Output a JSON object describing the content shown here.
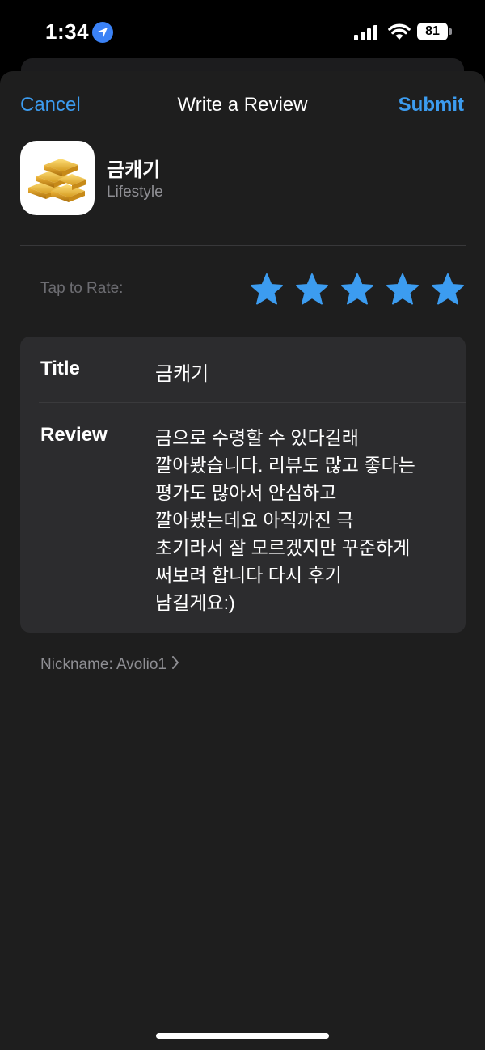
{
  "status_bar": {
    "time": "1:34",
    "battery": "81",
    "location_icon": "location-arrow-icon",
    "signal_icon": "cellular-signal-icon",
    "wifi_icon": "wifi-icon"
  },
  "nav": {
    "cancel": "Cancel",
    "title": "Write a Review",
    "submit": "Submit"
  },
  "app": {
    "name": "금캐기",
    "category": "Lifestyle",
    "icon": "gold-bars-icon"
  },
  "rating": {
    "label": "Tap to Rate:",
    "value": 5,
    "max": 5,
    "star_color": "#3c9cf0"
  },
  "form": {
    "title_label": "Title",
    "title_value": "금캐기",
    "review_label": "Review",
    "review_value": "금으로 수령할 수 있다길래\n깔아봤습니다. 리뷰도 많고 좋다는\n평가도 많아서 안심하고\n깔아봤는데요 아직까진 극\n초기라서 잘 모르겠지만 꾸준하게\n써보려 합니다 다시 후기\n남길게요:)"
  },
  "nickname": {
    "text": "Nickname: Avolio1"
  },
  "colors": {
    "accent": "#3c9cf0",
    "sheet_bg": "#1e1e1e",
    "form_bg": "#2c2c2e"
  }
}
